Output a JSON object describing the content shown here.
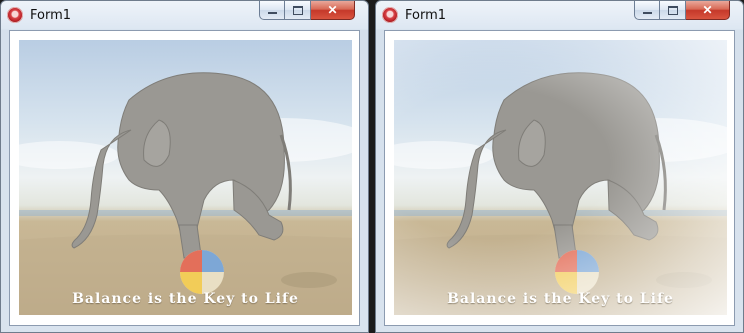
{
  "windows": [
    {
      "title": "Form1",
      "caption": "Balance is the Key to Life",
      "buttons": {
        "minimize": "",
        "maximize": "",
        "close": "✕"
      }
    },
    {
      "title": "Form1",
      "caption": "Balance is the Key to Life",
      "buttons": {
        "minimize": "",
        "maximize": "",
        "close": "✕"
      }
    }
  ],
  "colors": {
    "title_bar": "#dde7f2",
    "close_button": "#c5382a",
    "client_bg": "#ffffff",
    "desktop": "#1b1b1b"
  },
  "icons": [
    "app-icon",
    "minimize-icon",
    "maximize-icon",
    "close-icon"
  ]
}
